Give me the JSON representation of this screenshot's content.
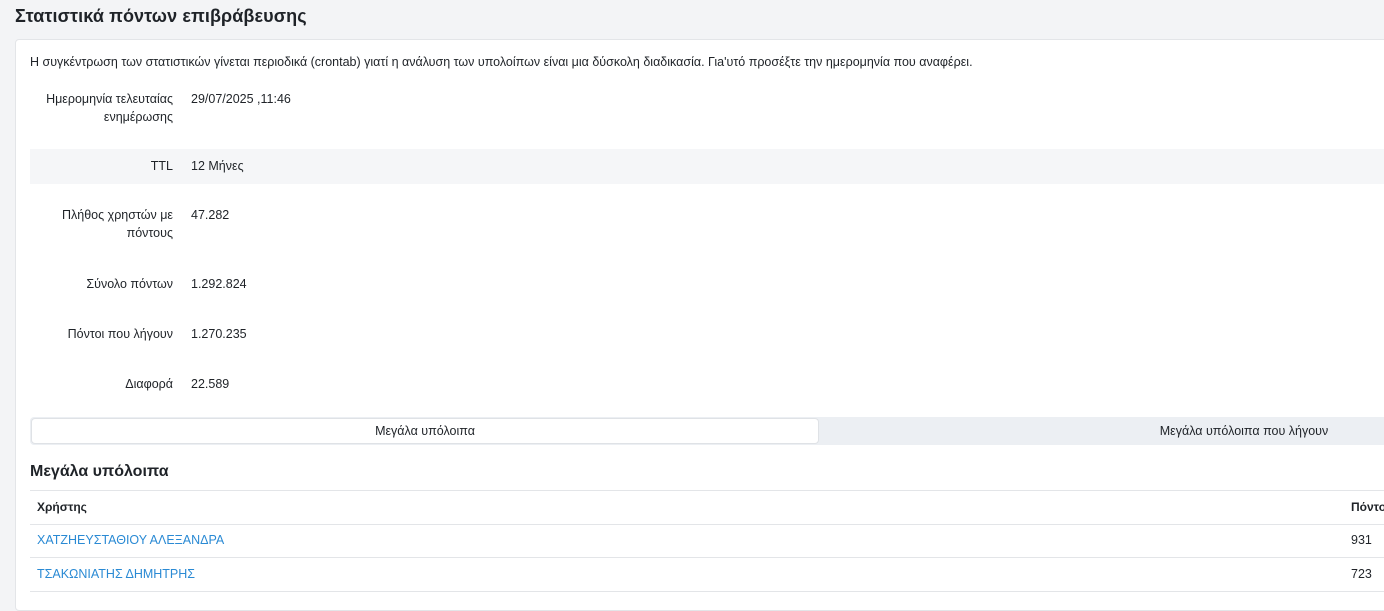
{
  "page": {
    "title": "Στατιστικά πόντων επιβράβευσης"
  },
  "intro": "Η συγκέντρωση των στατιστικών γίνεται περιοδικά (crontab) γιατί η ανάλυση των υπολοίπων είναι μια δύσκολη διαδικασία. Γιa'υτό προσέξτε την ημερομηνία που αναφέρει.",
  "stats": [
    {
      "label": "Ημερομηνία τελευταίας ενημέρωσης",
      "value": "29/07/2025 ,11:46"
    },
    {
      "label": "TTL",
      "value": "12 Μήνες"
    },
    {
      "label": "Πλήθος χρηστών με πόντους",
      "value": "47.282"
    },
    {
      "label": "Σύνολο πόντων",
      "value": "1.292.824"
    },
    {
      "label": "Πόντοι που λήγουν",
      "value": "1.270.235"
    },
    {
      "label": "Διαφορά",
      "value": "22.589"
    }
  ],
  "tabs": [
    {
      "label": "Μεγάλα υπόλοιπα",
      "active": true
    },
    {
      "label": "Μεγάλα υπόλοιπα που λήγουν",
      "active": false
    }
  ],
  "table": {
    "title": "Μεγάλα υπόλοιπα",
    "columns": [
      "Χρήστης",
      "Πόντο"
    ],
    "rows": [
      {
        "user": "ΧΑΤΖΗΕΥΣΤΑΘΙΟΥ ΑΛΕΞΑΝΔΡΑ",
        "points": "931"
      },
      {
        "user": "ΤΣΑΚΩΝΙΑΤΗΣ ΔΗΜΗΤΡΗΣ",
        "points": "723"
      }
    ]
  },
  "colors": {
    "link": "#2a8ad4",
    "background": "#f3f4f6",
    "panel": "#ffffff"
  }
}
